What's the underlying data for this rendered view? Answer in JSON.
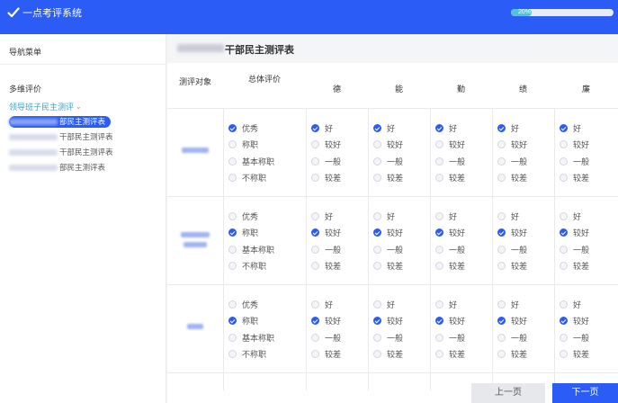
{
  "app": {
    "title": "一点考评系统",
    "progress_label": "20%",
    "progress": 0.2
  },
  "sidebar": {
    "nav_title": "导航菜单",
    "group_title": "多维评价",
    "sub_title": "领导班子民主测评",
    "items": [
      {
        "label": "部民主测评表",
        "active": true
      },
      {
        "label": "干部民主测评表",
        "active": false
      },
      {
        "label": "干部民主测评表",
        "active": false
      },
      {
        "label": "部民主测评表",
        "active": false
      }
    ]
  },
  "main": {
    "title": "干部民主测评表",
    "columns": [
      "测评对象",
      "总体评价",
      "德",
      "能",
      "勤",
      "绩",
      "廉"
    ],
    "overall_options": [
      "优秀",
      "称职",
      "基本称职",
      "不称职"
    ],
    "dim_options": [
      "好",
      "较好",
      "一般",
      "较差"
    ],
    "rows": [
      {
        "overall": 0,
        "dims": [
          0,
          0,
          0,
          0,
          0
        ]
      },
      {
        "overall": 1,
        "dims": [
          1,
          1,
          1,
          1,
          1
        ]
      },
      {
        "overall": 1,
        "dims": [
          1,
          1,
          1,
          1,
          1
        ]
      }
    ]
  },
  "footer": {
    "prev_label": "上一页",
    "next_label": "下一页"
  },
  "colors": {
    "primary": "#2b5cf5",
    "accent": "#3aa2c4",
    "chevron": "#f08a2a"
  }
}
